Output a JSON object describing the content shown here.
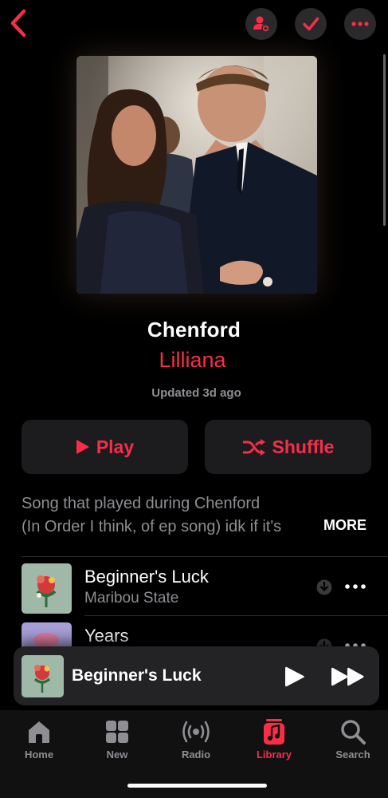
{
  "header": {
    "back_icon": "chevron-left-icon",
    "add_user_icon": "person-add-icon",
    "check_icon": "checkmark-icon",
    "more_icon": "ellipsis-icon",
    "accent": "#fa2d48"
  },
  "playlist": {
    "title": "Chenford",
    "curator": "Lilliana",
    "updated": "Updated 3d ago",
    "play_label": "Play",
    "shuffle_label": "Shuffle",
    "description_line1": "Song that played during Chenford",
    "description_line2": "(In Order I think, of ep song) idk if it's",
    "more_label": "MORE"
  },
  "tracks": [
    {
      "title": "Beginner's Luck",
      "artist": "Maribou State"
    },
    {
      "title": "Years",
      "artist": ""
    }
  ],
  "mini_player": {
    "title": "Beginner's Luck"
  },
  "tabs": [
    {
      "label": "Home",
      "icon": "home-icon",
      "active": false
    },
    {
      "label": "New",
      "icon": "grid-icon",
      "active": false
    },
    {
      "label": "Radio",
      "icon": "radio-icon",
      "active": false
    },
    {
      "label": "Library",
      "icon": "music-library-icon",
      "active": true
    },
    {
      "label": "Search",
      "icon": "search-icon",
      "active": false
    }
  ]
}
